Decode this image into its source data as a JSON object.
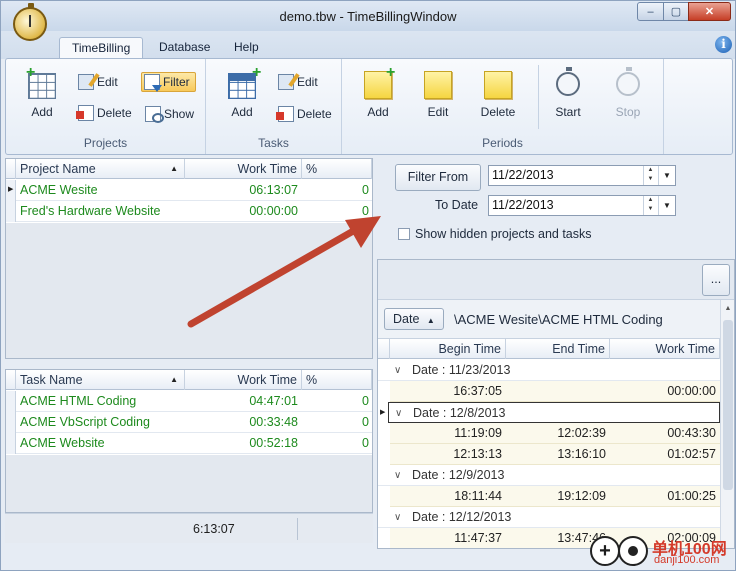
{
  "window": {
    "title": "demo.tbw - TimeBillingWindow",
    "controls": {
      "minimize": "–",
      "maximize": "▢",
      "close": "✕"
    }
  },
  "ribbon": {
    "tabs": [
      "TimeBilling",
      "Database",
      "Help"
    ],
    "active_tab": "TimeBilling",
    "help_icon": "i",
    "groups": {
      "projects": {
        "label": "Projects",
        "add": "Add",
        "edit": "Edit",
        "delete": "Delete",
        "filter": "Filter",
        "show": "Show"
      },
      "tasks": {
        "label": "Tasks",
        "add": "Add",
        "edit": "Edit",
        "delete": "Delete"
      },
      "periods": {
        "label": "Periods",
        "add": "Add",
        "edit": "Edit",
        "delete": "Delete",
        "start": "Start",
        "stop": "Stop"
      }
    }
  },
  "projects_grid": {
    "headers": [
      "Project Name",
      "Work Time",
      "%"
    ],
    "rows": [
      {
        "name": "ACME Wesite",
        "work_time": "06:13:07",
        "pct": "0"
      },
      {
        "name": "Fred's Hardware Website",
        "work_time": "00:00:00",
        "pct": "0"
      }
    ]
  },
  "tasks_grid": {
    "headers": [
      "Task Name",
      "Work Time",
      "%"
    ],
    "rows": [
      {
        "name": "ACME HTML Coding",
        "work_time": "04:47:01",
        "pct": "0"
      },
      {
        "name": "ACME VbScript Coding",
        "work_time": "00:33:48",
        "pct": "0"
      },
      {
        "name": "ACME Website",
        "work_time": "00:52:18",
        "pct": "0"
      }
    ]
  },
  "status_total": "6:13:07",
  "filter": {
    "filter_from_button": "Filter From",
    "from_date": "11/22/2013",
    "to_label": "To Date",
    "to_date": "11/22/2013",
    "show_hidden_label": "Show hidden projects and tasks",
    "show_hidden_checked": false
  },
  "periods": {
    "more_button": "...",
    "group_by_tag": "Date",
    "path": "\\ACME Wesite\\ACME HTML Coding",
    "headers": [
      "Begin Time",
      "End Time",
      "Work Time"
    ],
    "groups": [
      {
        "label": "Date : 11/23/2013",
        "rows": [
          {
            "begin": "16:37:05",
            "end": "",
            "work": "00:00:00"
          }
        ]
      },
      {
        "label": "Date : 12/8/2013",
        "selected": true,
        "rows": [
          {
            "begin": "11:19:09",
            "end": "12:02:39",
            "work": "00:43:30"
          },
          {
            "begin": "12:13:13",
            "end": "13:16:10",
            "work": "01:02:57"
          }
        ]
      },
      {
        "label": "Date : 12/9/2013",
        "rows": [
          {
            "begin": "18:11:44",
            "end": "19:12:09",
            "work": "01:00:25"
          }
        ]
      },
      {
        "label": "Date : 12/12/2013",
        "rows": [
          {
            "begin": "11:47:37",
            "end": "13:47:46",
            "work": "02:00:09"
          }
        ]
      }
    ]
  },
  "watermark": {
    "text1": "单机100网",
    "text2": "danji100.com"
  },
  "colors": {
    "accent": "#1d8a1d",
    "annotation_arrow": "#c0432f"
  }
}
